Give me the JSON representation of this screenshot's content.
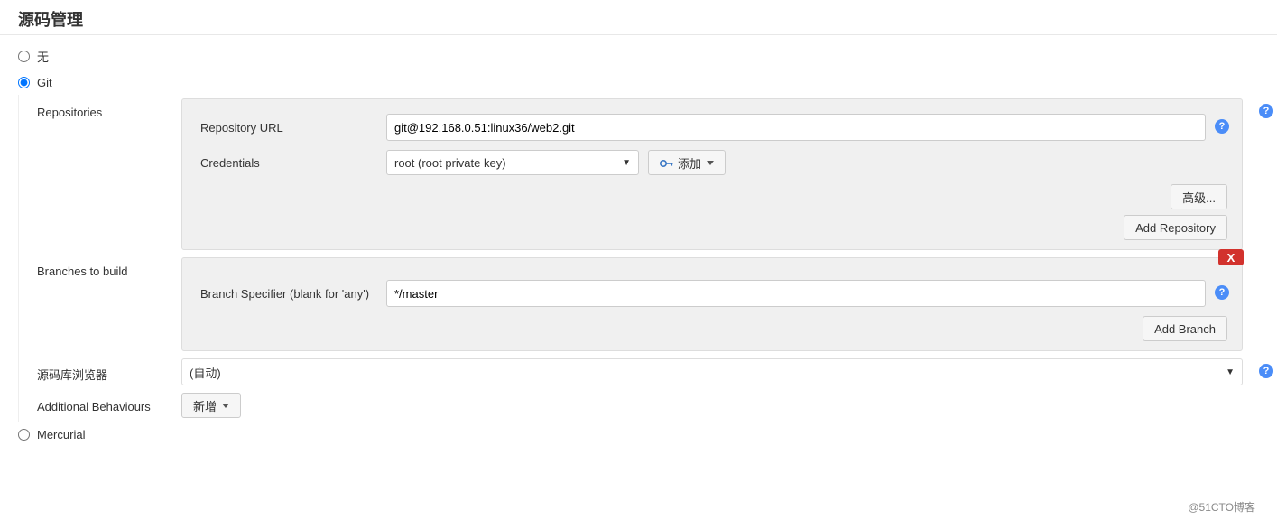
{
  "heading": "源码管理",
  "scm_options": {
    "none": {
      "label": "无",
      "selected": false
    },
    "git": {
      "label": "Git",
      "selected": true
    },
    "mercurial": {
      "label": "Mercurial",
      "selected": false
    }
  },
  "git": {
    "repositories": {
      "section_label": "Repositories",
      "url_label": "Repository URL",
      "url_value": "git@192.168.0.51:linux36/web2.git",
      "cred_label": "Credentials",
      "cred_selected": "root (root private key)",
      "add_cred_label": "添加",
      "advanced_button": "高级...",
      "add_repo_button": "Add Repository"
    },
    "branches": {
      "section_label": "Branches to build",
      "specifier_label": "Branch Specifier (blank for 'any')",
      "specifier_value": "*/master",
      "add_branch_button": "Add Branch",
      "close_label": "X"
    },
    "browser": {
      "section_label": "源码库浏览器",
      "selected": "(自动)"
    },
    "behaviours": {
      "section_label": "Additional Behaviours",
      "add_button": "新增"
    }
  },
  "help_glyph": "?",
  "watermark": "@51CTO博客"
}
